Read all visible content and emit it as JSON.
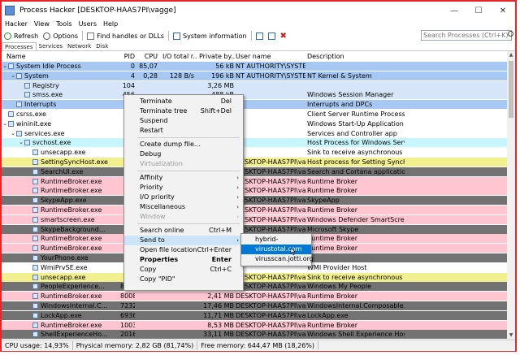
{
  "window": {
    "title": "Process Hacker [DESKTOP-HAAS7PI\\vagge]",
    "min": "—",
    "max": "☐",
    "close": "✕"
  },
  "menu": [
    "Hacker",
    "View",
    "Tools",
    "Users",
    "Help"
  ],
  "toolbar": {
    "refresh": "Refresh",
    "options": "Options",
    "find": "Find handles or DLLs",
    "sysinfo": "System information",
    "search_placeholder": "Search Processes (Ctrl+K)"
  },
  "tabs": [
    "Processes",
    "Services",
    "Network",
    "Disk"
  ],
  "columns": [
    "Name",
    "PID",
    "CPU",
    "I/O total r...",
    "Private by...",
    "User name",
    "Description"
  ],
  "colors": {
    "blue": "#a6c8f2",
    "light_blue": "#d6e6f8",
    "cyan": "#c8f6ff",
    "pink": "#ffc6d2",
    "yellow": "#f2ef8e",
    "dark": "#727272",
    "purple": "#d7b3f5",
    "white": "#ffffff",
    "accent": "#0078d7",
    "frame": "#e8262a"
  },
  "processes": [
    {
      "name": "System Idle Process",
      "pid": "0",
      "cpu": "85,07",
      "io": "",
      "priv": "56 kB",
      "user": "NT AUTHORITY\\SYSTEM",
      "desc": "",
      "indent": 0,
      "exp": "⌄",
      "bg": "#a6c8f2",
      "fg": "#000"
    },
    {
      "name": "System",
      "pid": "4",
      "cpu": "0,28",
      "io": "128 B/s",
      "priv": "196 kB",
      "user": "NT AUTHORITY\\SYSTEM",
      "desc": "NT Kernel & System",
      "indent": 1,
      "exp": "⌄",
      "bg": "#a6c8f2",
      "fg": "#000"
    },
    {
      "name": "Registry",
      "pid": "104",
      "cpu": "",
      "io": "",
      "priv": "3,26 MB",
      "user": "",
      "desc": "",
      "indent": 2,
      "exp": "",
      "bg": "#d6e6f8",
      "fg": "#000"
    },
    {
      "name": "smss.exe",
      "pid": "456",
      "cpu": "",
      "io": "",
      "priv": "488 kB",
      "user": "",
      "desc": "Windows Session Manager",
      "indent": 2,
      "exp": "",
      "bg": "#d6e6f8",
      "fg": "#000"
    },
    {
      "name": "Interrupts",
      "pid": "",
      "cpu": "",
      "io": "",
      "priv": "",
      "user": "",
      "desc": "Interrupts and DPCs",
      "indent": 1,
      "exp": "",
      "bg": "#a6c8f2",
      "fg": "#000"
    },
    {
      "name": "csrss.exe",
      "pid": "",
      "cpu": "",
      "io": "",
      "priv": "",
      "user": "",
      "desc": "Client Server Runtime Process",
      "indent": 0,
      "exp": "",
      "bg": "#ffffff",
      "fg": "#000"
    },
    {
      "name": "wininit.exe",
      "pid": "",
      "cpu": "",
      "io": "",
      "priv": "",
      "user": "",
      "desc": "Windows Start-Up Application",
      "indent": 0,
      "exp": "⌄",
      "bg": "#ffffff",
      "fg": "#000"
    },
    {
      "name": "services.exe",
      "pid": "",
      "cpu": "",
      "io": "",
      "priv": "",
      "user": "",
      "desc": "Services and Controller app",
      "indent": 1,
      "exp": "⌄",
      "bg": "#ffffff",
      "fg": "#000"
    },
    {
      "name": "svchost.exe",
      "pid": "",
      "cpu": "",
      "io": "",
      "priv": "",
      "user": "",
      "desc": "Host Process for Windows Serv...",
      "indent": 2,
      "exp": "⌄",
      "bg": "#c8f6ff",
      "fg": "#000"
    },
    {
      "name": "unsecapp.exe",
      "pid": "4",
      "cpu": "",
      "io": "",
      "priv": "",
      "user": "",
      "desc": "Sink to receive asynchronous c...",
      "indent": 3,
      "exp": "",
      "bg": "#ffffff",
      "fg": "#000"
    },
    {
      "name": "SettingSyncHost.exe",
      "pid": "6",
      "cpu": "",
      "io": "",
      "priv": "",
      "user": "DESKTOP-HAAS7PI\\vagge",
      "desc": "Host process for Setting Synch...",
      "indent": 3,
      "exp": "",
      "bg": "#f2ef8e",
      "fg": "#000"
    },
    {
      "name": "SearchUI.exe",
      "pid": "6",
      "cpu": "",
      "io": "",
      "priv": "",
      "user": "DESKTOP-HAAS7PI\\vagge",
      "desc": "Search and Cortana application",
      "indent": 3,
      "exp": "",
      "bg": "#727272",
      "fg": "#000"
    },
    {
      "name": "RuntimeBroker.exe",
      "pid": "6",
      "cpu": "",
      "io": "",
      "priv": "",
      "user": "DESKTOP-HAAS7PI\\vagge",
      "desc": "Runtime Broker",
      "indent": 3,
      "exp": "",
      "bg": "#ffc6d2",
      "fg": "#000"
    },
    {
      "name": "RuntimeBroker.exe",
      "pid": "6",
      "cpu": "",
      "io": "",
      "priv": "",
      "user": "DESKTOP-HAAS7PI\\vagge",
      "desc": "Runtime Broker",
      "indent": 3,
      "exp": "",
      "bg": "#ffc6d2",
      "fg": "#000"
    },
    {
      "name": "SkypeApp.exe",
      "pid": "6",
      "cpu": "",
      "io": "",
      "priv": "",
      "user": "DESKTOP-HAAS7PI\\vagge",
      "desc": "SkypeApp",
      "indent": 3,
      "exp": "",
      "bg": "#727272",
      "fg": "#000"
    },
    {
      "name": "RuntimeBroker.exe",
      "pid": "6",
      "cpu": "",
      "io": "",
      "priv": "",
      "user": "DESKTOP-HAAS7PI\\vagge",
      "desc": "Runtime Broker",
      "indent": 3,
      "exp": "",
      "bg": "#ffc6d2",
      "fg": "#000"
    },
    {
      "name": "smartscreen.exe",
      "pid": "6",
      "cpu": "",
      "io": "",
      "priv": "",
      "user": "DESKTOP-HAAS7PI\\vagge",
      "desc": "Windows Defender SmartScre...",
      "indent": 3,
      "exp": "",
      "bg": "#ffc6d2",
      "fg": "#000"
    },
    {
      "name": "SkypeBackground...",
      "pid": "6",
      "cpu": "",
      "io": "",
      "priv": "",
      "user": "DESKTOP-HAAS7PI\\vagge",
      "desc": "Microsoft Skype",
      "indent": 3,
      "exp": "",
      "bg": "#727272",
      "fg": "#000"
    },
    {
      "name": "RuntimeBroker.exe",
      "pid": "6",
      "cpu": "",
      "io": "",
      "priv": "",
      "user": "DESKTOP-HAAS7PI\\vagge",
      "desc": "Runtime Broker",
      "indent": 3,
      "exp": "",
      "bg": "#ffc6d2",
      "fg": "#000"
    },
    {
      "name": "RuntimeBroker.exe",
      "pid": "6",
      "cpu": "",
      "io": "",
      "priv": "",
      "user": "DESKTOP-HAAS7PI\\vagge",
      "desc": "Runtime Broker",
      "indent": 3,
      "exp": "",
      "bg": "#ffc6d2",
      "fg": "#000"
    },
    {
      "name": "YourPhone.exe",
      "pid": "6",
      "cpu": "",
      "io": "",
      "priv": "",
      "user": "",
      "desc": "",
      "indent": 3,
      "exp": "",
      "bg": "#727272",
      "fg": "#000"
    },
    {
      "name": "WmiPrvSE.exe",
      "pid": "",
      "cpu": "",
      "io": "",
      "priv": "",
      "user": "",
      "desc": "WMI Provider Host",
      "indent": 3,
      "exp": "",
      "bg": "#ffffff",
      "fg": "#000"
    },
    {
      "name": "unsecapp.exe",
      "pid": "",
      "cpu": "",
      "io": "",
      "priv": "",
      "user": "DESKTOP-HAAS7PI\\vagge",
      "desc": "Sink to receive asynchronous c...",
      "indent": 3,
      "exp": "",
      "bg": "#f2ef8e",
      "fg": "#000"
    },
    {
      "name": "PeopleExperience...",
      "pid": "8004",
      "cpu": "",
      "io": "",
      "priv": "",
      "user": "DESKTOP-HAAS7PI\\vagge",
      "desc": "Windows My People",
      "indent": 3,
      "exp": "",
      "bg": "#727272",
      "fg": "#000"
    },
    {
      "name": "RuntimeBroker.exe",
      "pid": "8008",
      "cpu": "",
      "io": "",
      "priv": "2,41 MB",
      "user": "DESKTOP-HAAS7PI\\vagge",
      "desc": "Runtime Broker",
      "indent": 3,
      "exp": "",
      "bg": "#ffc6d2",
      "fg": "#000"
    },
    {
      "name": "WindowsInternal.C...",
      "pid": "7232",
      "cpu": "",
      "io": "",
      "priv": "17,46 MB",
      "user": "DESKTOP-HAAS7PI\\vagge",
      "desc": "WindowsInternal.Composable...",
      "indent": 3,
      "exp": "",
      "bg": "#727272",
      "fg": "#000"
    },
    {
      "name": "LockApp.exe",
      "pid": "6936",
      "cpu": "",
      "io": "",
      "priv": "11,71 MB",
      "user": "DESKTOP-HAAS7PI\\vagge",
      "desc": "LockApp.exe",
      "indent": 3,
      "exp": "",
      "bg": "#727272",
      "fg": "#000"
    },
    {
      "name": "RuntimeBroker.exe",
      "pid": "10032",
      "cpu": "",
      "io": "",
      "priv": "8,53 MB",
      "user": "DESKTOP-HAAS7PI\\vagge",
      "desc": "Runtime Broker",
      "indent": 3,
      "exp": "",
      "bg": "#ffc6d2",
      "fg": "#000"
    },
    {
      "name": "ShellExperienceHo...",
      "pid": "2016",
      "cpu": "",
      "io": "",
      "priv": "33,11 MB",
      "user": "DESKTOP-HAAS7PI\\vagge",
      "desc": "Windows Shell Experience Host",
      "indent": 3,
      "exp": "",
      "bg": "#727272",
      "fg": "#000"
    }
  ],
  "context_menu": [
    {
      "label": "Terminate",
      "shortcut": "Del"
    },
    {
      "label": "Terminate tree",
      "shortcut": "Shift+Del"
    },
    {
      "label": "Suspend"
    },
    {
      "label": "Restart"
    },
    {
      "sep": true
    },
    {
      "label": "Create dump file..."
    },
    {
      "label": "Debug"
    },
    {
      "label": "Virtualization",
      "disabled": true
    },
    {
      "sep": true
    },
    {
      "label": "Affinity",
      "arrow": "›"
    },
    {
      "label": "Priority",
      "arrow": "›"
    },
    {
      "label": "I/O priority",
      "arrow": "›"
    },
    {
      "label": "Miscellaneous",
      "arrow": "›"
    },
    {
      "label": "Window",
      "arrow": "›",
      "disabled": true
    },
    {
      "sep": true
    },
    {
      "label": "Search online",
      "shortcut": "Ctrl+M"
    },
    {
      "label": "Send to",
      "arrow": "›",
      "highlight": true
    },
    {
      "label": "Open file location",
      "shortcut": "Ctrl+Enter"
    },
    {
      "label": "Properties",
      "shortcut": "Enter",
      "bold": true
    },
    {
      "label": "Copy",
      "shortcut": "Ctrl+C"
    },
    {
      "label": "Copy \"PID\""
    }
  ],
  "send_to": [
    {
      "label": "hybrid-analysis.com"
    },
    {
      "label": "virustotal.com",
      "highlight": true
    },
    {
      "label": "virusscan.jotti.org"
    }
  ],
  "status": {
    "cpu": "CPU usage: 14,93%",
    "phys": "Physical memory: 2,82 GB (81,74%)",
    "free": "Free memory: 644,47 MB (18,26%)"
  }
}
